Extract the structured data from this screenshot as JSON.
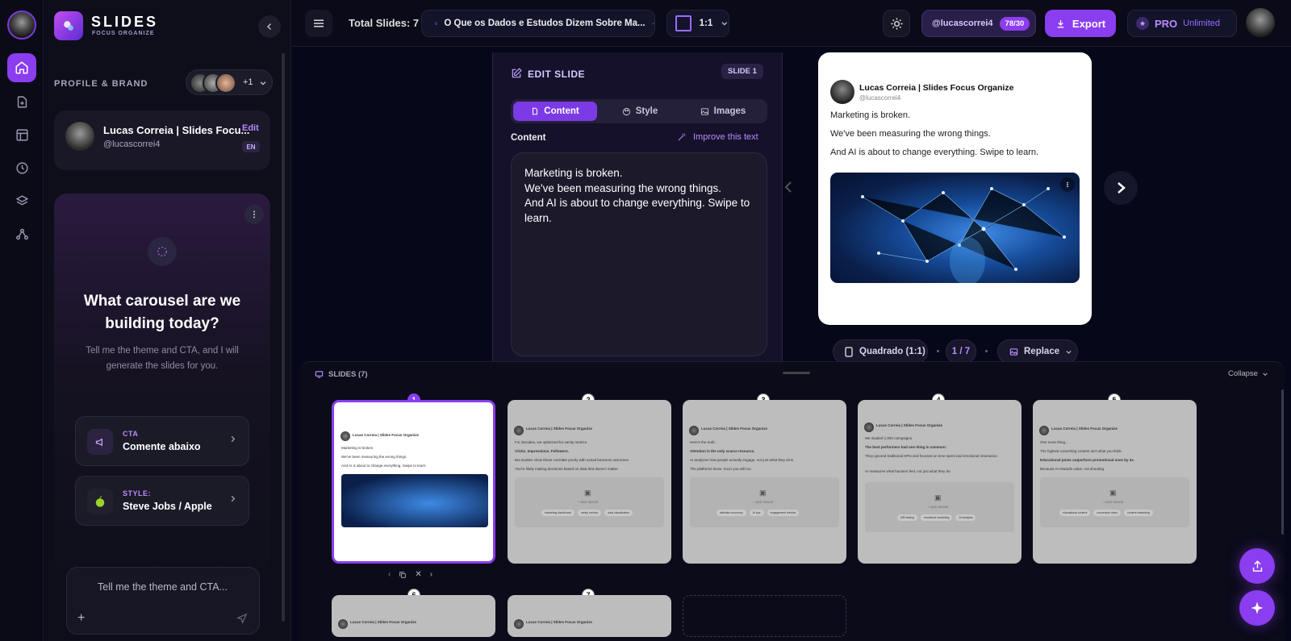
{
  "app": {
    "name": "SLIDES",
    "subtitle": "FOCUS ORGANIZE"
  },
  "sidebar": {
    "section_label": "PROFILE & BRAND",
    "avatar_extra": "+1",
    "profile": {
      "name": "Lucas Correia | Slides Focu...",
      "handle": "@lucascorrei4",
      "edit": "Edit",
      "lang": "EN"
    },
    "chat": {
      "heading": "What carousel are we building today?",
      "subtext": "Tell me the theme and CTA, and I will generate the slides for you.",
      "cta_label": "CTA",
      "cta_value": "Comente abaixo",
      "style_label": "STYLE:",
      "style_value": "Steve Jobs / Apple",
      "composer_placeholder": "Tell me the theme and CTA..."
    }
  },
  "topbar": {
    "total_slides": "Total Slides: 7",
    "doc_title": "O Que os Dados e Estudos Dizem Sobre Ma...",
    "ratio": "1:1",
    "account": "@lucascorrei4",
    "credits": "78/30",
    "export": "Export",
    "plan": "PRO",
    "plan_detail": "Unlimited"
  },
  "editor": {
    "title": "EDIT SLIDE",
    "slide_badge": "SLIDE 1",
    "tabs": [
      "Content",
      "Style",
      "Images"
    ],
    "content_label": "Content",
    "improve": "Improve this text",
    "content_text": "Marketing is broken.\nWe've been measuring the wrong things.\nAnd AI is about to change everything. Swipe to learn."
  },
  "preview": {
    "author": "Lucas Correia | Slides Focus Organize",
    "handle": "@lucascorrei4",
    "lines": [
      "Marketing is broken.",
      "We've been measuring the wrong things.",
      "And AI is about to change everything. Swipe to learn."
    ],
    "format": "Quadrado (1:1)",
    "pager": "1 / 7",
    "replace": "Replace"
  },
  "strip": {
    "label": "SLIDES (7)",
    "collapse": "Collapse",
    "thumbs": [
      {
        "num": "1",
        "lines": [
          "Marketing is broken.",
          "We've been measuring the wrong things.",
          "And AI is about to change everything. Swipe to learn."
        ],
        "tags": []
      },
      {
        "num": "2",
        "lines": [
          "For decades, we optimized for vanity metrics.",
          "Clicks. Impressions. Followers.",
          "But studies show these correlate poorly with actual business outcomes.",
          "You're likely making decisions based on data that doesn't matter."
        ],
        "tags": [
          "marketing dashboard",
          "vanity metrics",
          "data visualization"
        ]
      },
      {
        "num": "3",
        "lines": [
          "Here's the truth:",
          "Attention is the only scarce resource.",
          "AI analyzes how people actually engage, not just what they click.",
          "The platforms know. Soon you will too."
        ],
        "tags": [
          "attention economy",
          "AI eye",
          "engagement metrics"
        ]
      },
      {
        "num": "4",
        "lines": [
          "We studied 1,000 campaigns.",
          "The best performers had one thing in common:",
          "They ignored traditional KPIs and focused on time spent and emotional resonance.",
          "AI measures what humans feel, not just what they do."
        ],
        "tags": [
          "A/B testing",
          "emotional marketing",
          "AI analysis"
        ]
      },
      {
        "num": "5",
        "lines": [
          "One more thing...",
          "The highest converting content isn't what you think.",
          "Educational posts outperform promotional ones by 3x.",
          "Because AI rewards value, not shouting."
        ],
        "tags": [
          "educational content",
          "conversion rates",
          "content marketing"
        ]
      },
      {
        "num": "6",
        "lines": [],
        "tags": []
      },
      {
        "num": "7",
        "lines": [],
        "tags": []
      }
    ],
    "add_image": "+ ADD IMAGE"
  }
}
